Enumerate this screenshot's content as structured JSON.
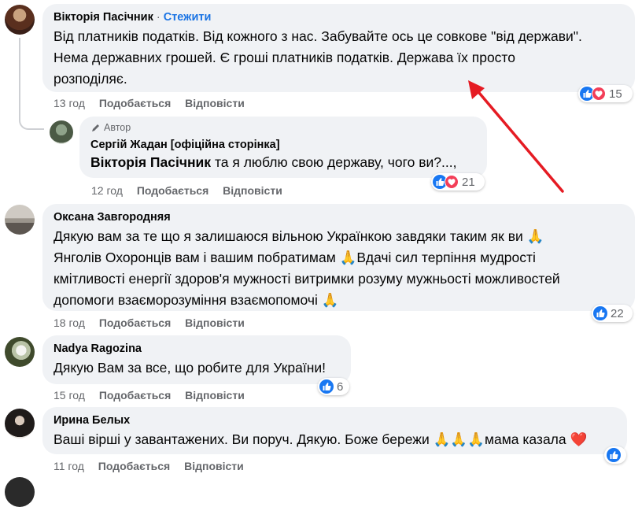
{
  "comments": [
    {
      "author": "Вікторія Пасічник",
      "follow": "Стежити",
      "dot": "·",
      "lines": [
        "Від платників податків. Від кожного з нас. Забувайте ось це совкове \"від держави\".",
        "Нема державних грошей. Є гроші платників податків. Держава їх просто",
        "розподіляє."
      ],
      "time": "13 год",
      "like": "Подобається",
      "reply": "Відповісти",
      "reactions": "15"
    },
    {
      "badge": "Автор",
      "author": "Сергій Жадан [офіційна сторінка]",
      "mention": "Вікторія Пасічник",
      "text": " та я люблю свою державу, чого ви?...,",
      "time": "12 год",
      "like": "Подобається",
      "reply": "Відповісти",
      "reactions": "21"
    },
    {
      "author": "Оксана Завгородняя",
      "lines": [
        "Дякую вам за те що я залишаюся вільною Українкою завдяки таким як ви 🙏",
        "Янголів Охоронців вам і вашим побратимам 🙏Вдачі сил терпіння мудрості",
        "кмітливості енергії здоров'я мужності витримки розуму мужньості можливостей",
        "допомоги взаєморозуміння взаємопомочі 🙏"
      ],
      "time": "18 год",
      "like": "Подобається",
      "reply": "Відповісти",
      "reactions": "22"
    },
    {
      "author": "Nadya Ragozina",
      "lines": [
        "Дякую Вам за все, що робите для України!"
      ],
      "time": "15 год",
      "like": "Подобається",
      "reply": "Відповісти",
      "reactions": "6"
    },
    {
      "author": "Ирина Белых",
      "lines": [
        "Ваші вірші у завантажених. Ви поруч. Дякую. Боже бережи 🙏🙏🙏мама казала ❤️"
      ],
      "time": "11 год",
      "like": "Подобається",
      "reply": "Відповісти"
    }
  ],
  "colors": {
    "bubble": "#f0f2f5",
    "link": "#1b74e4",
    "meta": "#65676b",
    "like": "#1877f2",
    "love": "#f33e58",
    "arrow": "#e51b23"
  },
  "icons": {
    "like": "thumbs-up-icon",
    "love": "heart-icon",
    "author_badge": "pencil-icon"
  }
}
